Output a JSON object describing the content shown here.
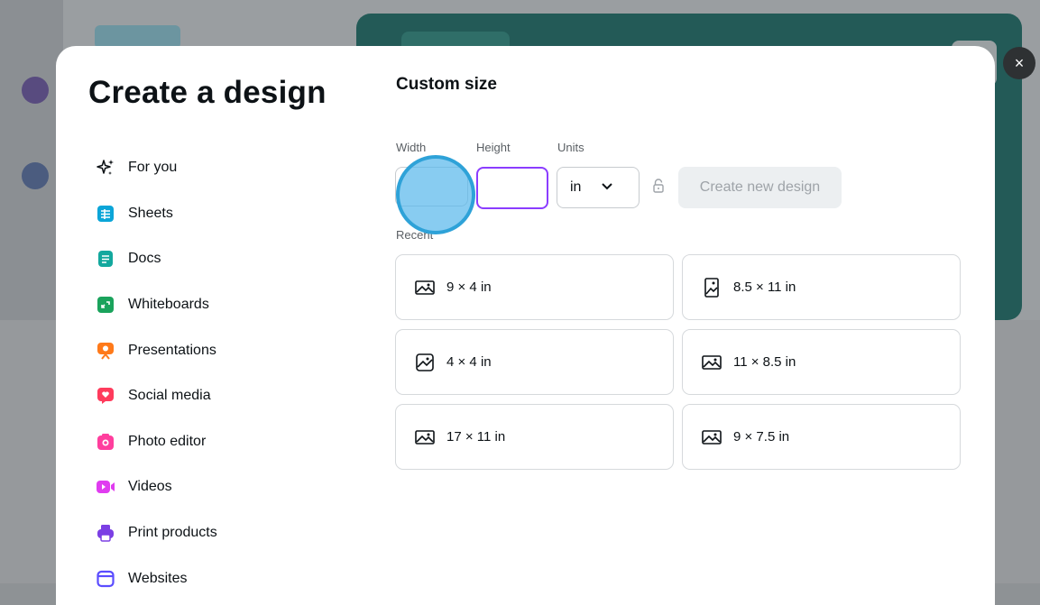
{
  "modal": {
    "title": "Create a design",
    "close_label": "×"
  },
  "sidebar": {
    "items": [
      {
        "label": "For you",
        "icon": "sparkles-icon",
        "color": "#0d1216"
      },
      {
        "label": "Sheets",
        "icon": "sheets-icon",
        "color": "#0ba5d8"
      },
      {
        "label": "Docs",
        "icon": "docs-icon",
        "color": "#13a89e"
      },
      {
        "label": "Whiteboards",
        "icon": "whiteboards-icon",
        "color": "#1aa35c"
      },
      {
        "label": "Presentations",
        "icon": "presentations-icon",
        "color": "#ff7a1a"
      },
      {
        "label": "Social media",
        "icon": "social-media-icon",
        "color": "#ff3b5c"
      },
      {
        "label": "Photo editor",
        "icon": "photo-editor-icon",
        "color": "#ff3e9d"
      },
      {
        "label": "Videos",
        "icon": "videos-icon",
        "color": "#e03cf0"
      },
      {
        "label": "Print products",
        "icon": "print-products-icon",
        "color": "#7b3fe4"
      },
      {
        "label": "Websites",
        "icon": "websites-icon",
        "color": "#5b4dff"
      }
    ]
  },
  "custom_size": {
    "title": "Custom size",
    "width_label": "Width",
    "height_label": "Height",
    "units_label": "Units",
    "width_value": "",
    "height_value": "",
    "units_value": "in",
    "create_button": "Create new design"
  },
  "recent": {
    "label": "Recent",
    "items": [
      {
        "label": "9 × 4 in",
        "icon": "landscape-image-icon"
      },
      {
        "label": "8.5 × 11 in",
        "icon": "portrait-image-icon"
      },
      {
        "label": "4 × 4 in",
        "icon": "square-image-icon"
      },
      {
        "label": "11 × 8.5 in",
        "icon": "landscape-image-icon"
      },
      {
        "label": "17 × 11 in",
        "icon": "landscape-image-icon"
      },
      {
        "label": "9 × 7.5 in",
        "icon": "landscape-image-icon"
      }
    ]
  },
  "colors": {
    "accent": "#8b3dff",
    "click_highlight": "#2ea2d8"
  }
}
